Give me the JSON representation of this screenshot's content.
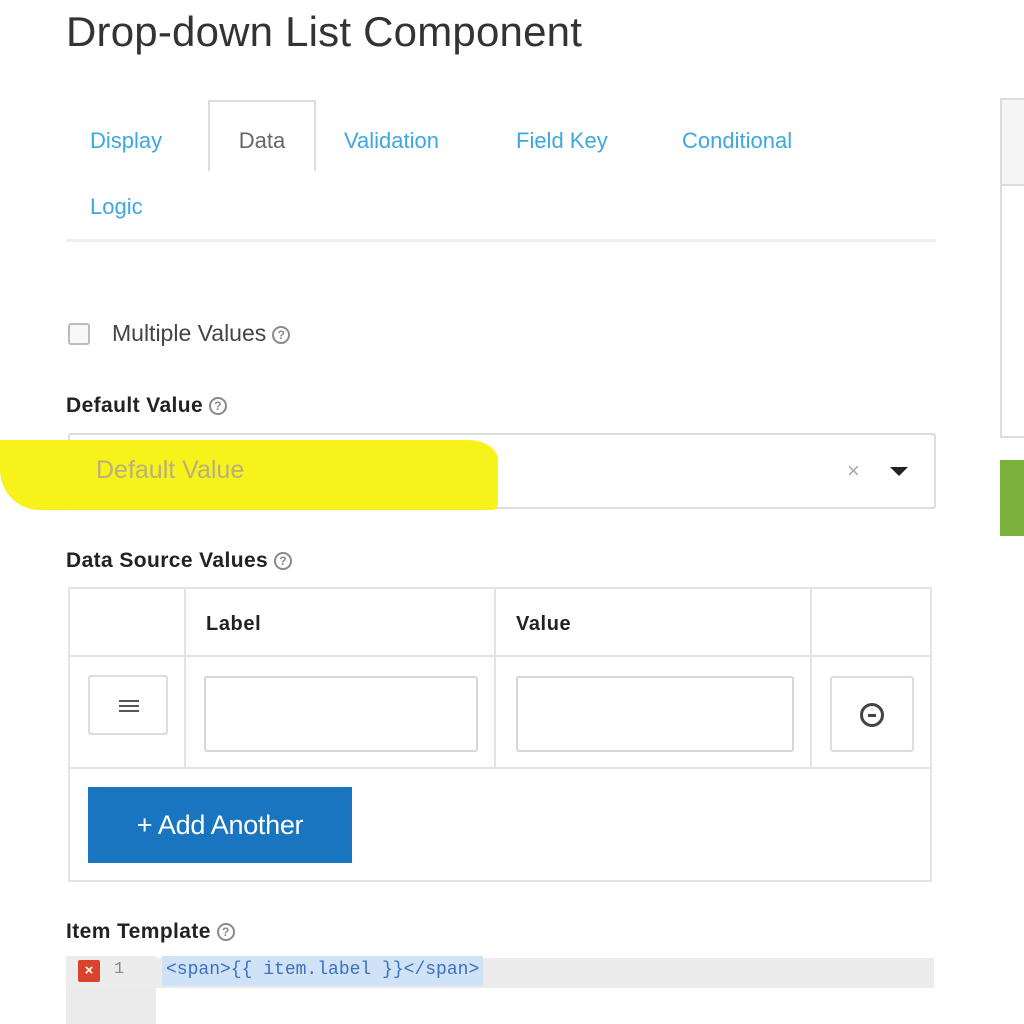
{
  "page": {
    "title": "Drop-down List Component"
  },
  "tabs": [
    {
      "label": "Display",
      "active": false
    },
    {
      "label": "Data",
      "active": true
    },
    {
      "label": "Validation",
      "active": false
    },
    {
      "label": "Field Key",
      "active": false
    },
    {
      "label": "Conditional",
      "active": false
    },
    {
      "label": "Logic",
      "active": false
    }
  ],
  "multiple_values": {
    "label": "Multiple Values",
    "checked": false,
    "help_icon": "question-circle-icon"
  },
  "default_value": {
    "label": "Default Value",
    "placeholder": "Default Value",
    "clear_glyph": "×",
    "help_icon": "question-circle-icon",
    "highlight_color": "#f7f10e"
  },
  "data_source": {
    "label": "Data Source Values",
    "help_icon": "question-circle-icon",
    "columns": [
      "Label",
      "Value"
    ],
    "rows": [
      {
        "label": "",
        "value": ""
      }
    ],
    "add_button_label": "+ Add Another",
    "add_button_color": "#1975bf"
  },
  "item_template": {
    "label": "Item Template",
    "help_icon": "question-circle-icon",
    "line_number": "1",
    "error_glyph": "×",
    "code": "<span>{{ item.label }}</span>"
  },
  "colors": {
    "tab_link": "#3da7e0",
    "accent_green": "#79b13c"
  }
}
